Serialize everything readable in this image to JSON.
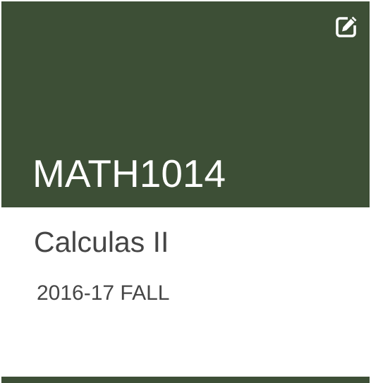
{
  "card": {
    "course_code": "MATH1014",
    "course_name": "Calculas II",
    "term": "2016-17 FALL",
    "edit_icon": "edit-icon",
    "header_color": "#3d4f36"
  }
}
